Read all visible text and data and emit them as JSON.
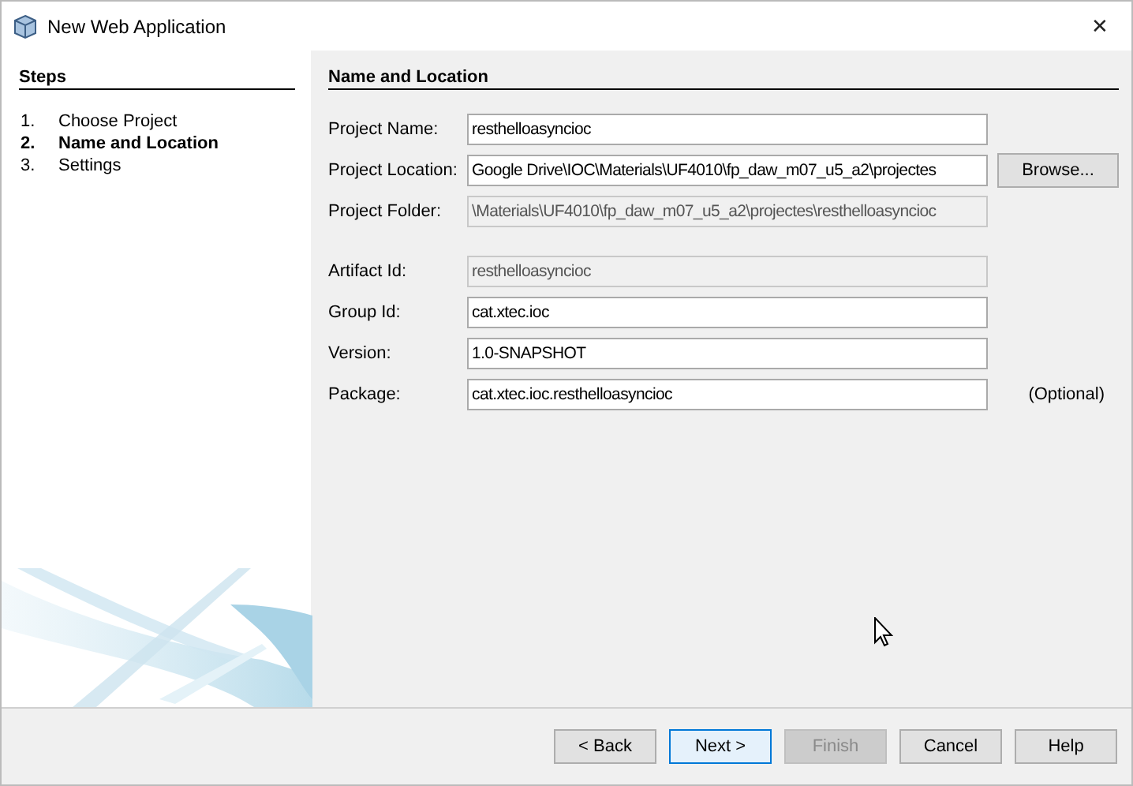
{
  "window": {
    "title": "New Web Application",
    "close": "✕"
  },
  "steps": {
    "title": "Steps",
    "items": [
      {
        "number": "1.",
        "label": "Choose Project",
        "selected": false
      },
      {
        "number": "2.",
        "label": "Name and Location",
        "selected": true
      },
      {
        "number": "3.",
        "label": "Settings",
        "selected": false
      }
    ]
  },
  "panel": {
    "title": "Name and Location",
    "field_groups": [
      [
        {
          "label": "Project Name:",
          "value": "resthelloasyncioc",
          "disabled": false
        },
        {
          "label": "Project Location:",
          "value": "Google Drive\\IOC\\Materials\\UF4010\\fp_daw_m07_u5_a2\\projectes",
          "disabled": false,
          "button": "Browse..."
        },
        {
          "label": "Project Folder:",
          "value": "\\Materials\\UF4010\\fp_daw_m07_u5_a2\\projectes\\resthelloasyncioc",
          "disabled": true
        }
      ],
      [
        {
          "label": "Artifact Id:",
          "value": "resthelloasyncioc",
          "disabled": true
        },
        {
          "label": "Group Id:",
          "value": "cat.xtec.ioc",
          "disabled": false
        },
        {
          "label": "Version:",
          "value": "1.0-SNAPSHOT",
          "disabled": false
        },
        {
          "label": "Package:",
          "value": "cat.xtec.ioc.resthelloasyncioc",
          "disabled": false,
          "note": "(Optional)"
        }
      ]
    ]
  },
  "buttons": [
    {
      "label": "< Back",
      "disabled": false,
      "default": false
    },
    {
      "label": "Next >",
      "disabled": false,
      "default": true
    },
    {
      "label": "Finish",
      "disabled": true,
      "default": false
    },
    {
      "label": "Cancel",
      "disabled": false,
      "default": false
    },
    {
      "label": "Help",
      "disabled": false,
      "default": false
    }
  ]
}
